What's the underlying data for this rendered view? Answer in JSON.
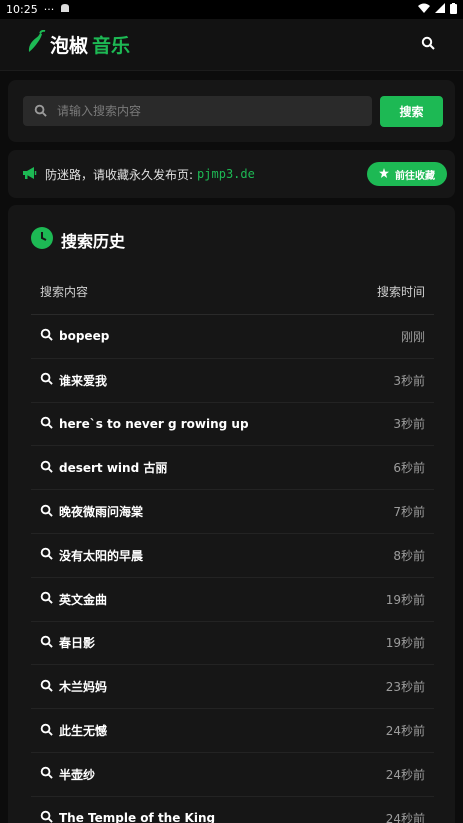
{
  "status": {
    "time": "10:25",
    "dots": "···"
  },
  "header": {
    "logo_part1": "泡椒",
    "logo_part2": "音乐"
  },
  "search": {
    "placeholder": "请输入搜索内容",
    "button": "搜索"
  },
  "notice": {
    "text": "防迷路，请收藏永久发布页:",
    "domain": "pjmp3.de",
    "button": "前往收藏"
  },
  "history": {
    "title": "搜索历史",
    "col_query": "搜索内容",
    "col_time": "搜索时间",
    "rows": [
      {
        "query": "bopeep",
        "time": "刚刚"
      },
      {
        "query": "谁来爱我",
        "time": "3秒前"
      },
      {
        "query": "here`s to never g rowing up",
        "time": "3秒前"
      },
      {
        "query": "desert wind 古丽",
        "time": "6秒前"
      },
      {
        "query": "晚夜微雨问海棠",
        "time": "7秒前"
      },
      {
        "query": "没有太阳的早晨",
        "time": "8秒前"
      },
      {
        "query": "英文金曲",
        "time": "19秒前"
      },
      {
        "query": "春日影",
        "time": "19秒前"
      },
      {
        "query": "木兰妈妈",
        "time": "23秒前"
      },
      {
        "query": "此生无憾",
        "time": "24秒前"
      },
      {
        "query": "半壶纱",
        "time": "24秒前"
      },
      {
        "query": "The Temple of the King",
        "time": "24秒前"
      }
    ]
  },
  "colors": {
    "accent": "#1db954",
    "background": "#0c0c0c",
    "card": "#161616"
  }
}
